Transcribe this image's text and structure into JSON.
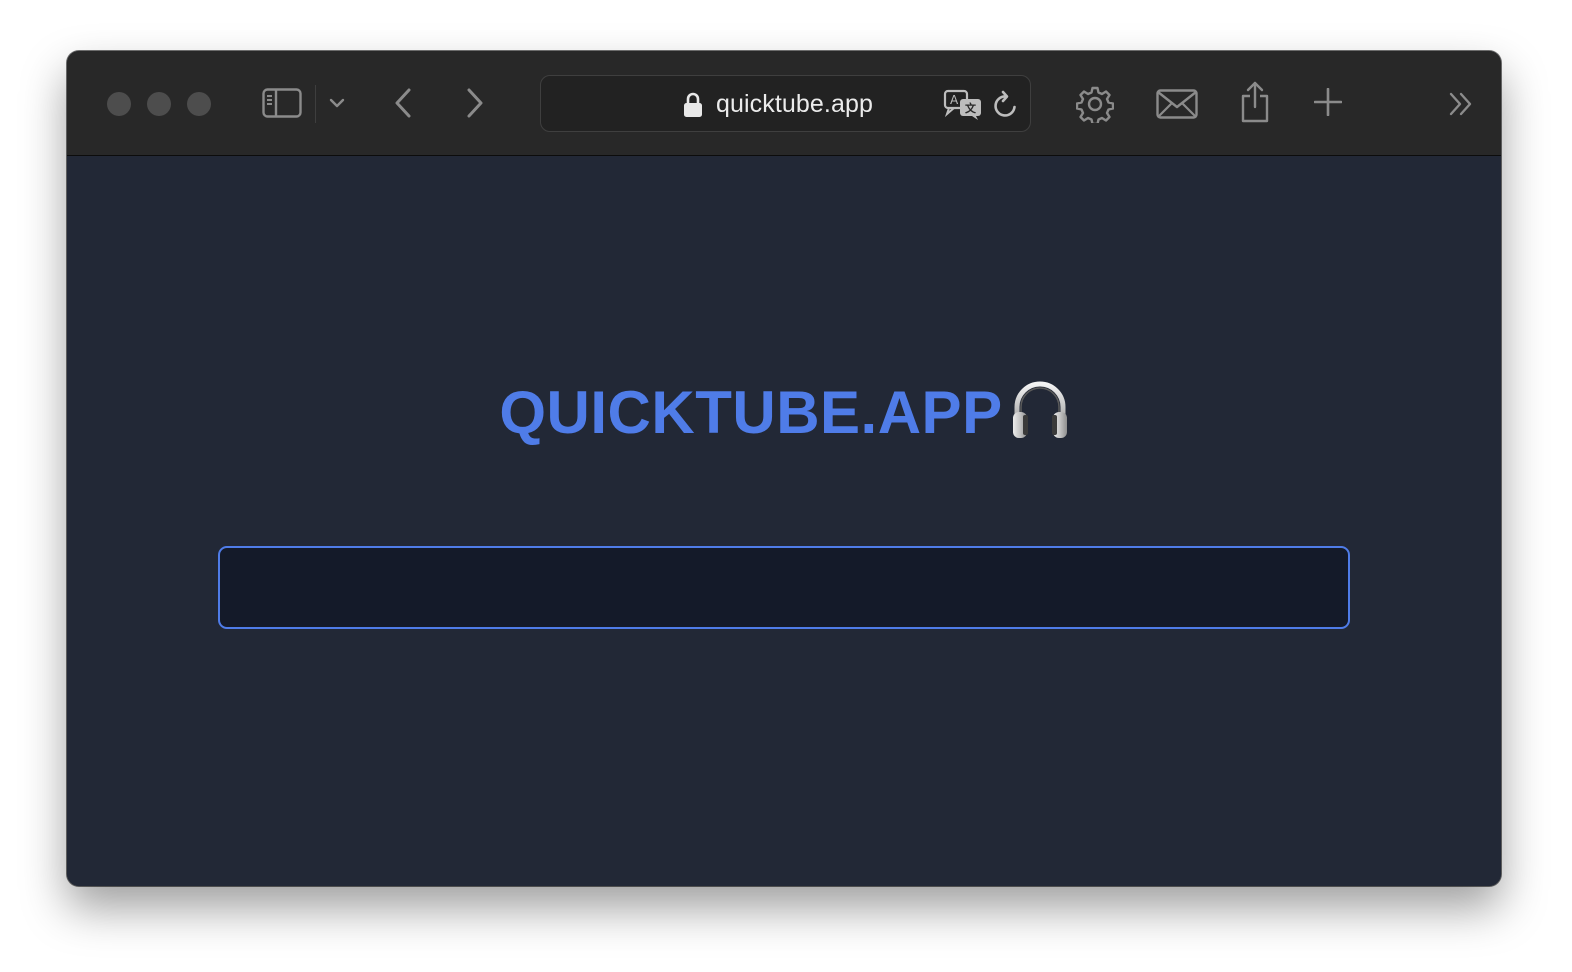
{
  "browser": {
    "url": "quicktube.app",
    "toolbar_icons": {
      "close": "traffic-light",
      "minimize": "traffic-light",
      "zoom": "traffic-light",
      "sidebar": "sidebar-icon",
      "sidebar_menu": "chevron-down-icon",
      "back": "chevron-left-icon",
      "forward": "chevron-right-icon",
      "secure": "lock-icon",
      "translate": "translate-icon",
      "reload": "reload-icon",
      "settings": "gear-icon",
      "mail": "mail-icon",
      "share": "share-icon",
      "new_tab": "plus-icon",
      "more": "double-chevron-right-icon"
    }
  },
  "page": {
    "title": "QUICKTUBE.APP",
    "title_emoji": "headphones-icon",
    "search": {
      "value": "",
      "placeholder": ""
    }
  },
  "colors": {
    "page_background": "#222836",
    "toolbar_background": "#282828",
    "accent": "#4f7ce8",
    "input_background": "#141a29"
  }
}
